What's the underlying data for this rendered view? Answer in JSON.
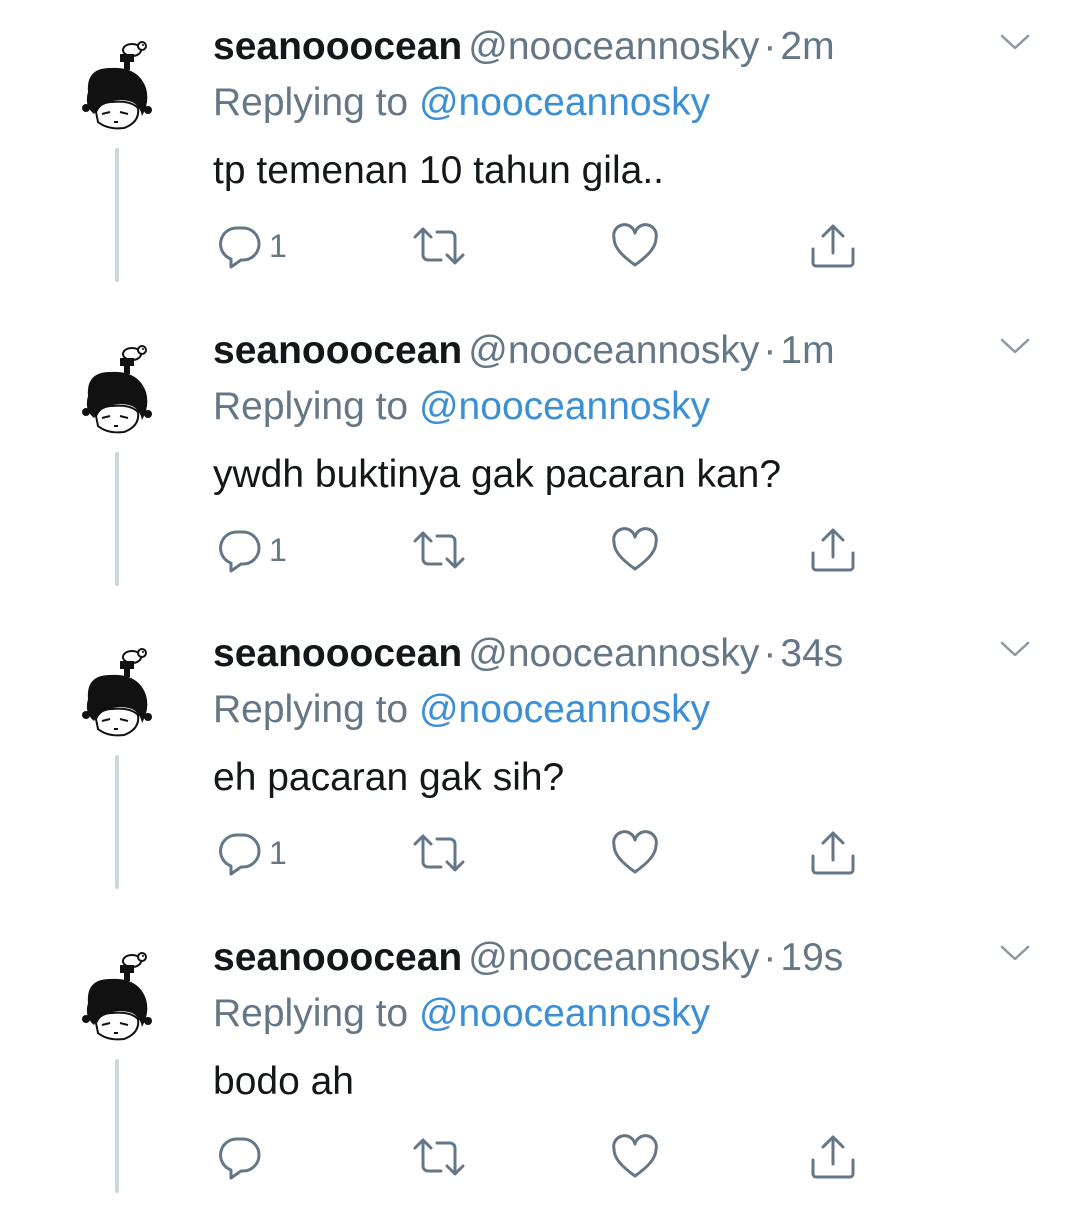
{
  "colors": {
    "name": "#14171a",
    "secondary": "#657786",
    "mention": "#3b8fd6",
    "thread_line": "#ccd6dd"
  },
  "tweets": [
    {
      "display_name": "seanooocean",
      "handle": "@nooceannosky",
      "time": "2m",
      "replying_label": "Replying to",
      "replying_to": "@nooceannosky",
      "text": "tp temenan 10 tahun gila..",
      "reply_count": "1"
    },
    {
      "display_name": "seanooocean",
      "handle": "@nooceannosky",
      "time": "1m",
      "replying_label": "Replying to",
      "replying_to": "@nooceannosky",
      "text": "ywdh buktinya gak pacaran kan?",
      "reply_count": "1"
    },
    {
      "display_name": "seanooocean",
      "handle": "@nooceannosky",
      "time": "34s",
      "replying_label": "Replying to",
      "replying_to": "@nooceannosky",
      "text": "eh pacaran gak sih?",
      "reply_count": "1"
    },
    {
      "display_name": "seanooocean",
      "handle": "@nooceannosky",
      "time": "19s",
      "replying_label": "Replying to",
      "replying_to": "@nooceannosky",
      "text": "bodo ah",
      "reply_count": ""
    }
  ],
  "icons": {
    "reply": "reply-icon",
    "retweet": "retweet-icon",
    "like": "heart-icon",
    "share": "share-icon",
    "caret": "chevron-down-icon",
    "avatar": "avatar-drawing"
  }
}
